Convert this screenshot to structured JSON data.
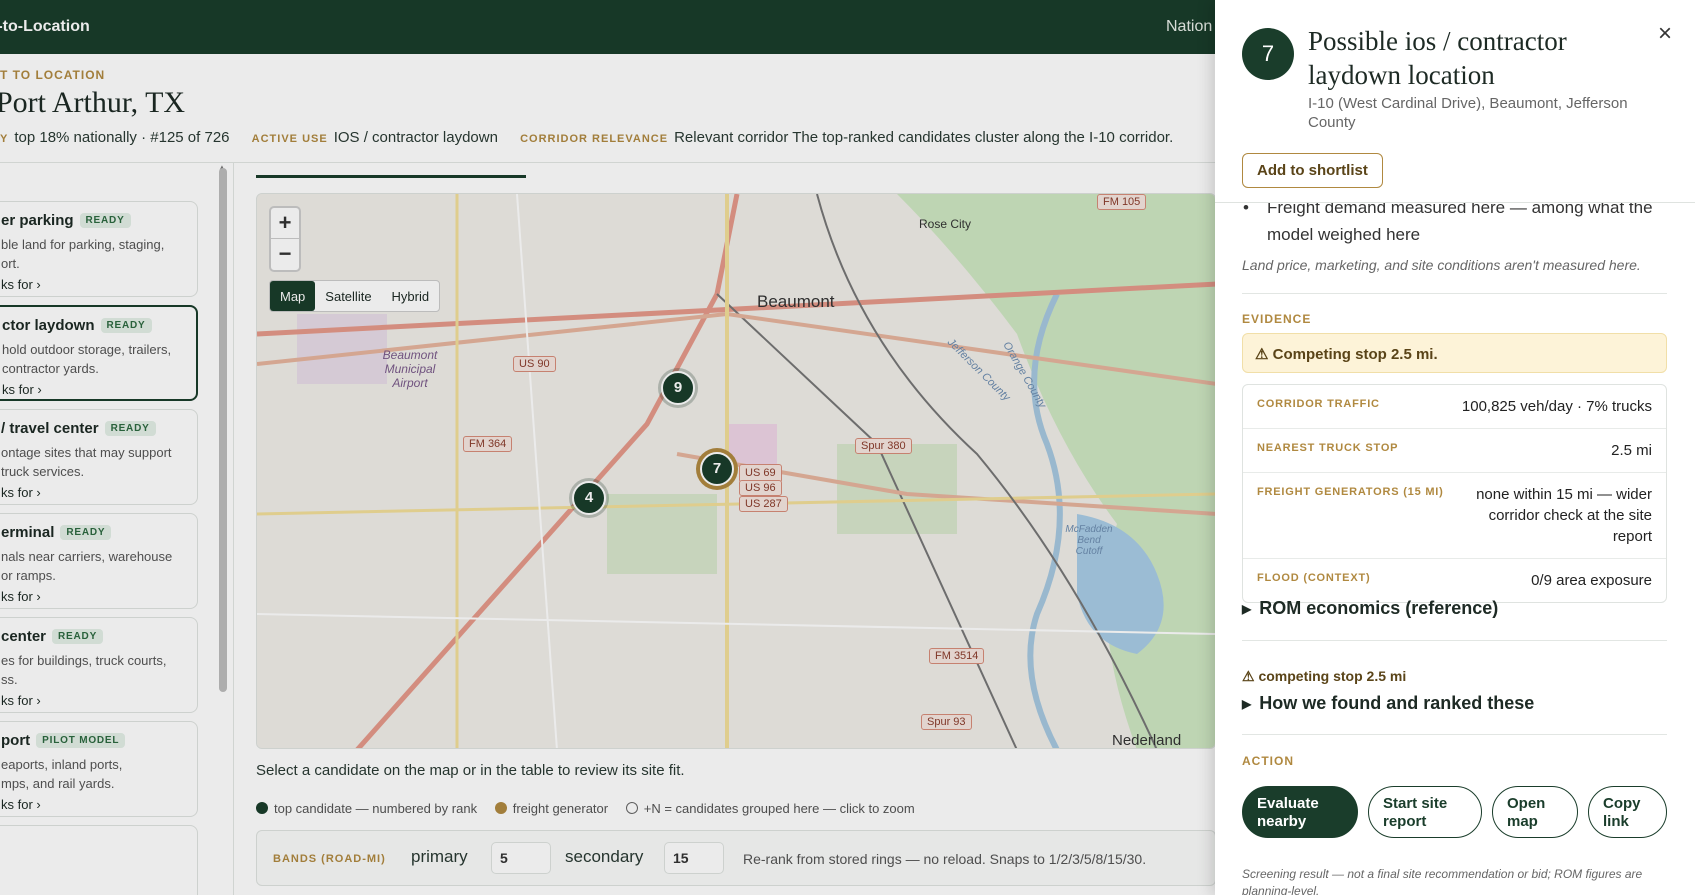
{
  "topbar": {
    "brand": "t-to-Location",
    "nav": "Nation"
  },
  "header": {
    "crumb": "T TO LOCATION",
    "city": "Port Arthur, TX",
    "stats": [
      {
        "key": "Y",
        "value": "top 18% nationally · #125 of 726"
      },
      {
        "key": "ACTIVE USE",
        "value": "IOS / contractor laydown"
      },
      {
        "key": "CORRIDOR RELEVANCE",
        "value": "Relevant corridor The top-ranked candidates cluster along the I-10 corridor."
      }
    ]
  },
  "uses": [
    {
      "title": "er parking",
      "badge": "READY",
      "desc": [
        "ble land for parking, staging,",
        "ort."
      ],
      "link": "ks for ›"
    },
    {
      "title": "ctor laydown",
      "badge": "READY",
      "desc": [
        "hold outdoor storage, trailers,",
        "contractor yards."
      ],
      "link": "ks for ›"
    },
    {
      "title": "/ travel center",
      "badge": "READY",
      "desc": [
        "ontage sites that may support",
        "truck services."
      ],
      "link": "ks for ›"
    },
    {
      "title": "erminal",
      "badge": "READY",
      "desc": [
        "nals near carriers, warehouse",
        "or ramps."
      ],
      "link": "ks for ›"
    },
    {
      "title": "center",
      "badge": "READY",
      "desc": [
        "es for buildings, truck courts,",
        "ss."
      ],
      "link": "ks for ›"
    },
    {
      "title": "port",
      "badge": "PILOT MODEL",
      "desc": [
        "eaports, inland ports,",
        "mps, and rail yards."
      ],
      "link": "ks for ›"
    }
  ],
  "map": {
    "zoom_in": "+",
    "zoom_out": "−",
    "types": [
      "Map",
      "Satellite",
      "Hybrid"
    ],
    "labels": {
      "beaumont": "Beaumont",
      "rose_city": "Rose City",
      "nederland": "Nederland",
      "airport": "Beaumont Municipal Airport",
      "jefferson": "Jefferson County",
      "orange": "Orange County",
      "mcfadden": "McFadden Bend Cutoff",
      "us90": "US 90",
      "fm364": "FM 364",
      "spur380": "Spur 380",
      "us69": "US 69",
      "us96": "US 96",
      "us287": "US 287",
      "fm3514": "FM 3514",
      "spur93": "Spur 93",
      "fm105": "FM 105"
    },
    "pins": [
      {
        "rank": "9"
      },
      {
        "rank": "7"
      },
      {
        "rank": "4"
      }
    ]
  },
  "hint": "Select a candidate on the map or in the table to review its site fit.",
  "legend": {
    "top": "top candidate — numbered by rank",
    "freight": "freight generator",
    "group": "+N = candidates grouped here — click to zoom",
    "colors": {
      "top": "#1a3d2b",
      "freight": "#b08940"
    }
  },
  "bands": {
    "key": "BANDS (ROAD-MI)",
    "primary_label": "primary",
    "primary_value": "5",
    "secondary_label": "secondary",
    "secondary_value": "15",
    "note": "Re-rank from stored rings — no reload. Snaps to 1/2/3/5/8/15/30."
  },
  "panel": {
    "rank": "7",
    "title": "Possible ios / contractor laydown location",
    "address": "I-10 (West Cardinal Drive), Beaumont, Jefferson County",
    "close": "×",
    "shortlist": "Add to shortlist",
    "bullet": "Freight demand measured here — among what the model weighed here",
    "caveat": "Land price, marketing, and site conditions aren't measured here.",
    "evidence_heading": "EVIDENCE",
    "warning": "⚠ Competing stop 2.5 mi.",
    "evidence": [
      {
        "key": "CORRIDOR TRAFFIC",
        "value": "100,825 veh/day · 7% trucks"
      },
      {
        "key": "NEAREST TRUCK STOP",
        "value": "2.5 mi"
      },
      {
        "key": "FREIGHT GENERATORS (15 MI)",
        "value": "none within 15 mi — wider corridor check at the site report"
      },
      {
        "key": "FLOOD (CONTEXT)",
        "value": "0/9 area exposure"
      }
    ],
    "rom": "ROM economics (reference)",
    "competing": "⚠ competing stop 2.5 mi",
    "how": "How we found and ranked these",
    "action_heading": "ACTION",
    "actions": [
      "Evaluate nearby",
      "Start site report",
      "Open map",
      "Copy link"
    ],
    "footnote": "Screening result — not a final site recommendation or bid; ROM figures are planning-level."
  }
}
